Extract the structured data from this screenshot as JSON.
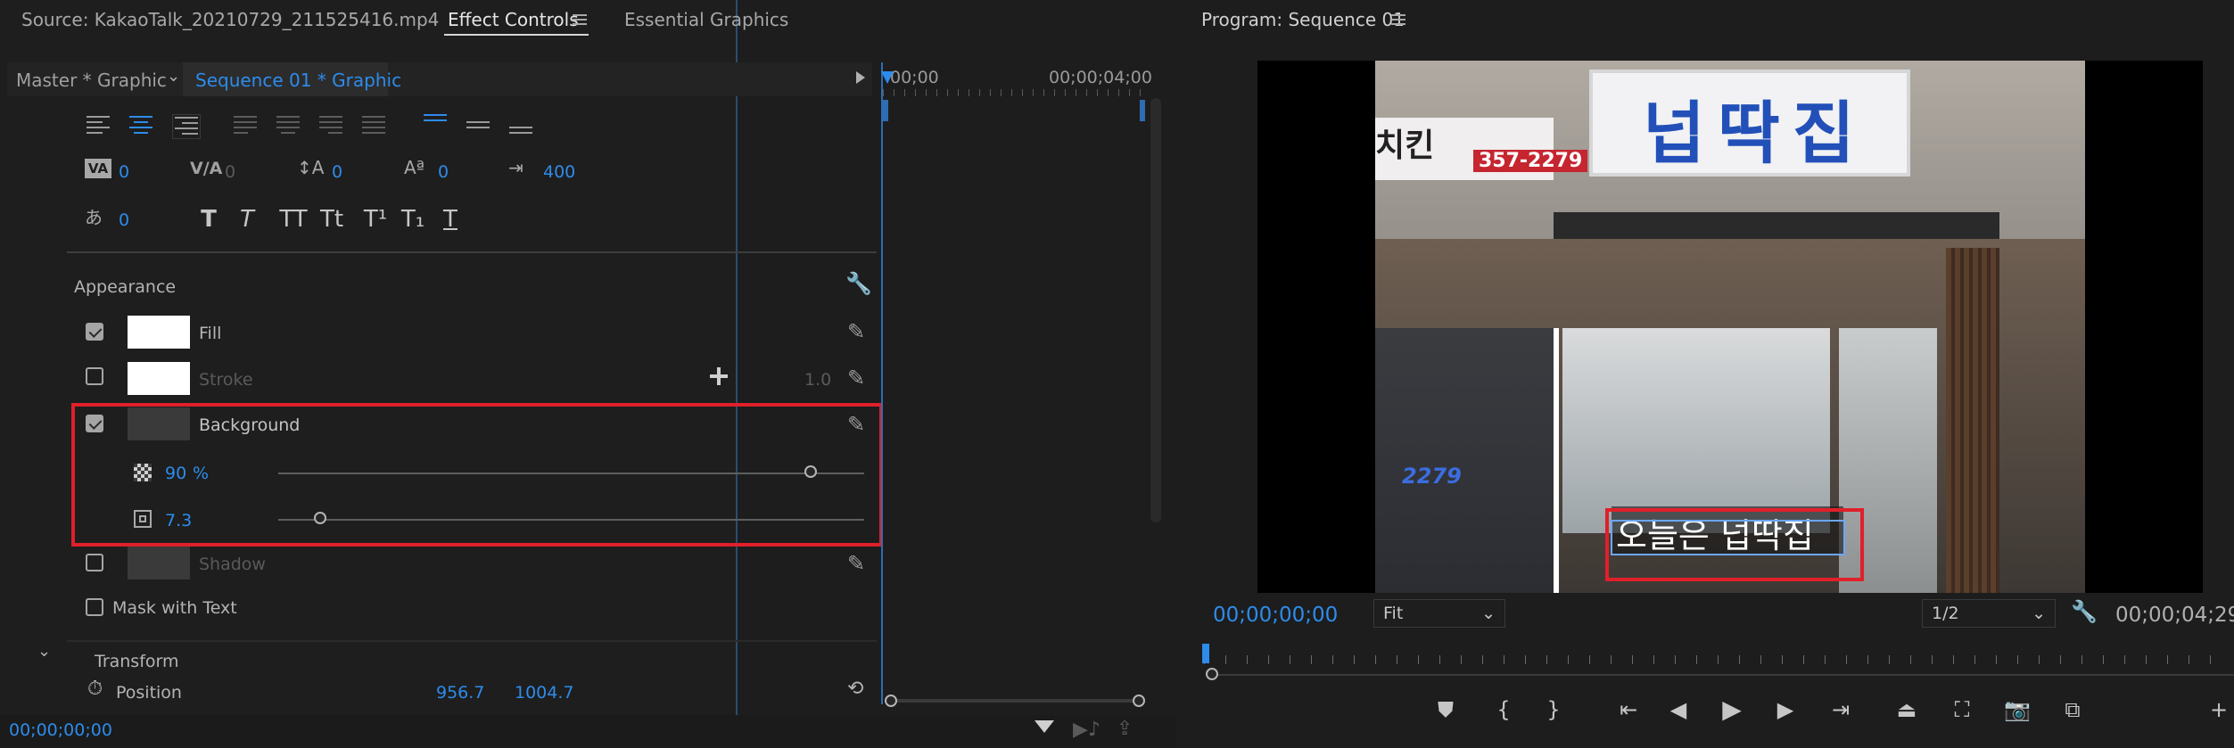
{
  "left_panel": {
    "tabs": [
      {
        "label": "Source: KakaoTalk_20210729_211525416.mp4"
      },
      {
        "label": "Effect Controls"
      },
      {
        "label": "Essential Graphics"
      }
    ],
    "master_label": "Master * Graphic",
    "sequence_label": "Sequence 01 * Graphic",
    "timeline_start": "00;00",
    "timeline_end": "00;00;04;00",
    "text_metrics": {
      "kerning": "0",
      "tracking": "0",
      "leading": "0",
      "baseline_shift": "0",
      "tab_width": "400",
      "tsume": "0"
    },
    "text_styles": [
      "T",
      "T",
      "TT",
      "Tt",
      "T¹",
      "T₁",
      "T"
    ],
    "appearance": {
      "heading": "Appearance",
      "fill_label": "Fill",
      "stroke_label": "Stroke",
      "stroke_width": "1.0",
      "background_label": "Background",
      "opacity_value": "90",
      "opacity_unit": "%",
      "size_value": "7.3",
      "shadow_label": "Shadow",
      "mask_label": "Mask with Text"
    },
    "transform": {
      "heading": "Transform",
      "position_label": "Position",
      "position_x": "956.7",
      "position_y": "1004.7"
    },
    "bottom_timecode": "00;00;00;00"
  },
  "program_monitor": {
    "title": "Program: Sequence 01",
    "timecode": "00;00;00;00",
    "fit_option": "Fit",
    "resolution_option": "1/2",
    "duration": "00;00;04;29",
    "caption_text": "오늘은 넙딱집",
    "sign_text": "넙딱집",
    "sign_left_text": "치킨",
    "sign_phone": "357-2279",
    "window_number": "2279"
  },
  "colors": {
    "accent": "#2d8ceb",
    "highlight_border": "#e0202a",
    "panel_bg": "#1d1d1d"
  },
  "icons": {
    "align_left": "align-left-icon",
    "align_center": "align-center-icon",
    "align_right": "align-right-icon",
    "justify": "justify-icon",
    "wrench": "wrench-icon",
    "eyedropper": "eyedropper-icon",
    "add": "plus-icon",
    "reset": "reset-icon",
    "stopwatch": "stopwatch-icon",
    "filter": "filter-icon",
    "play": "play-icon"
  }
}
